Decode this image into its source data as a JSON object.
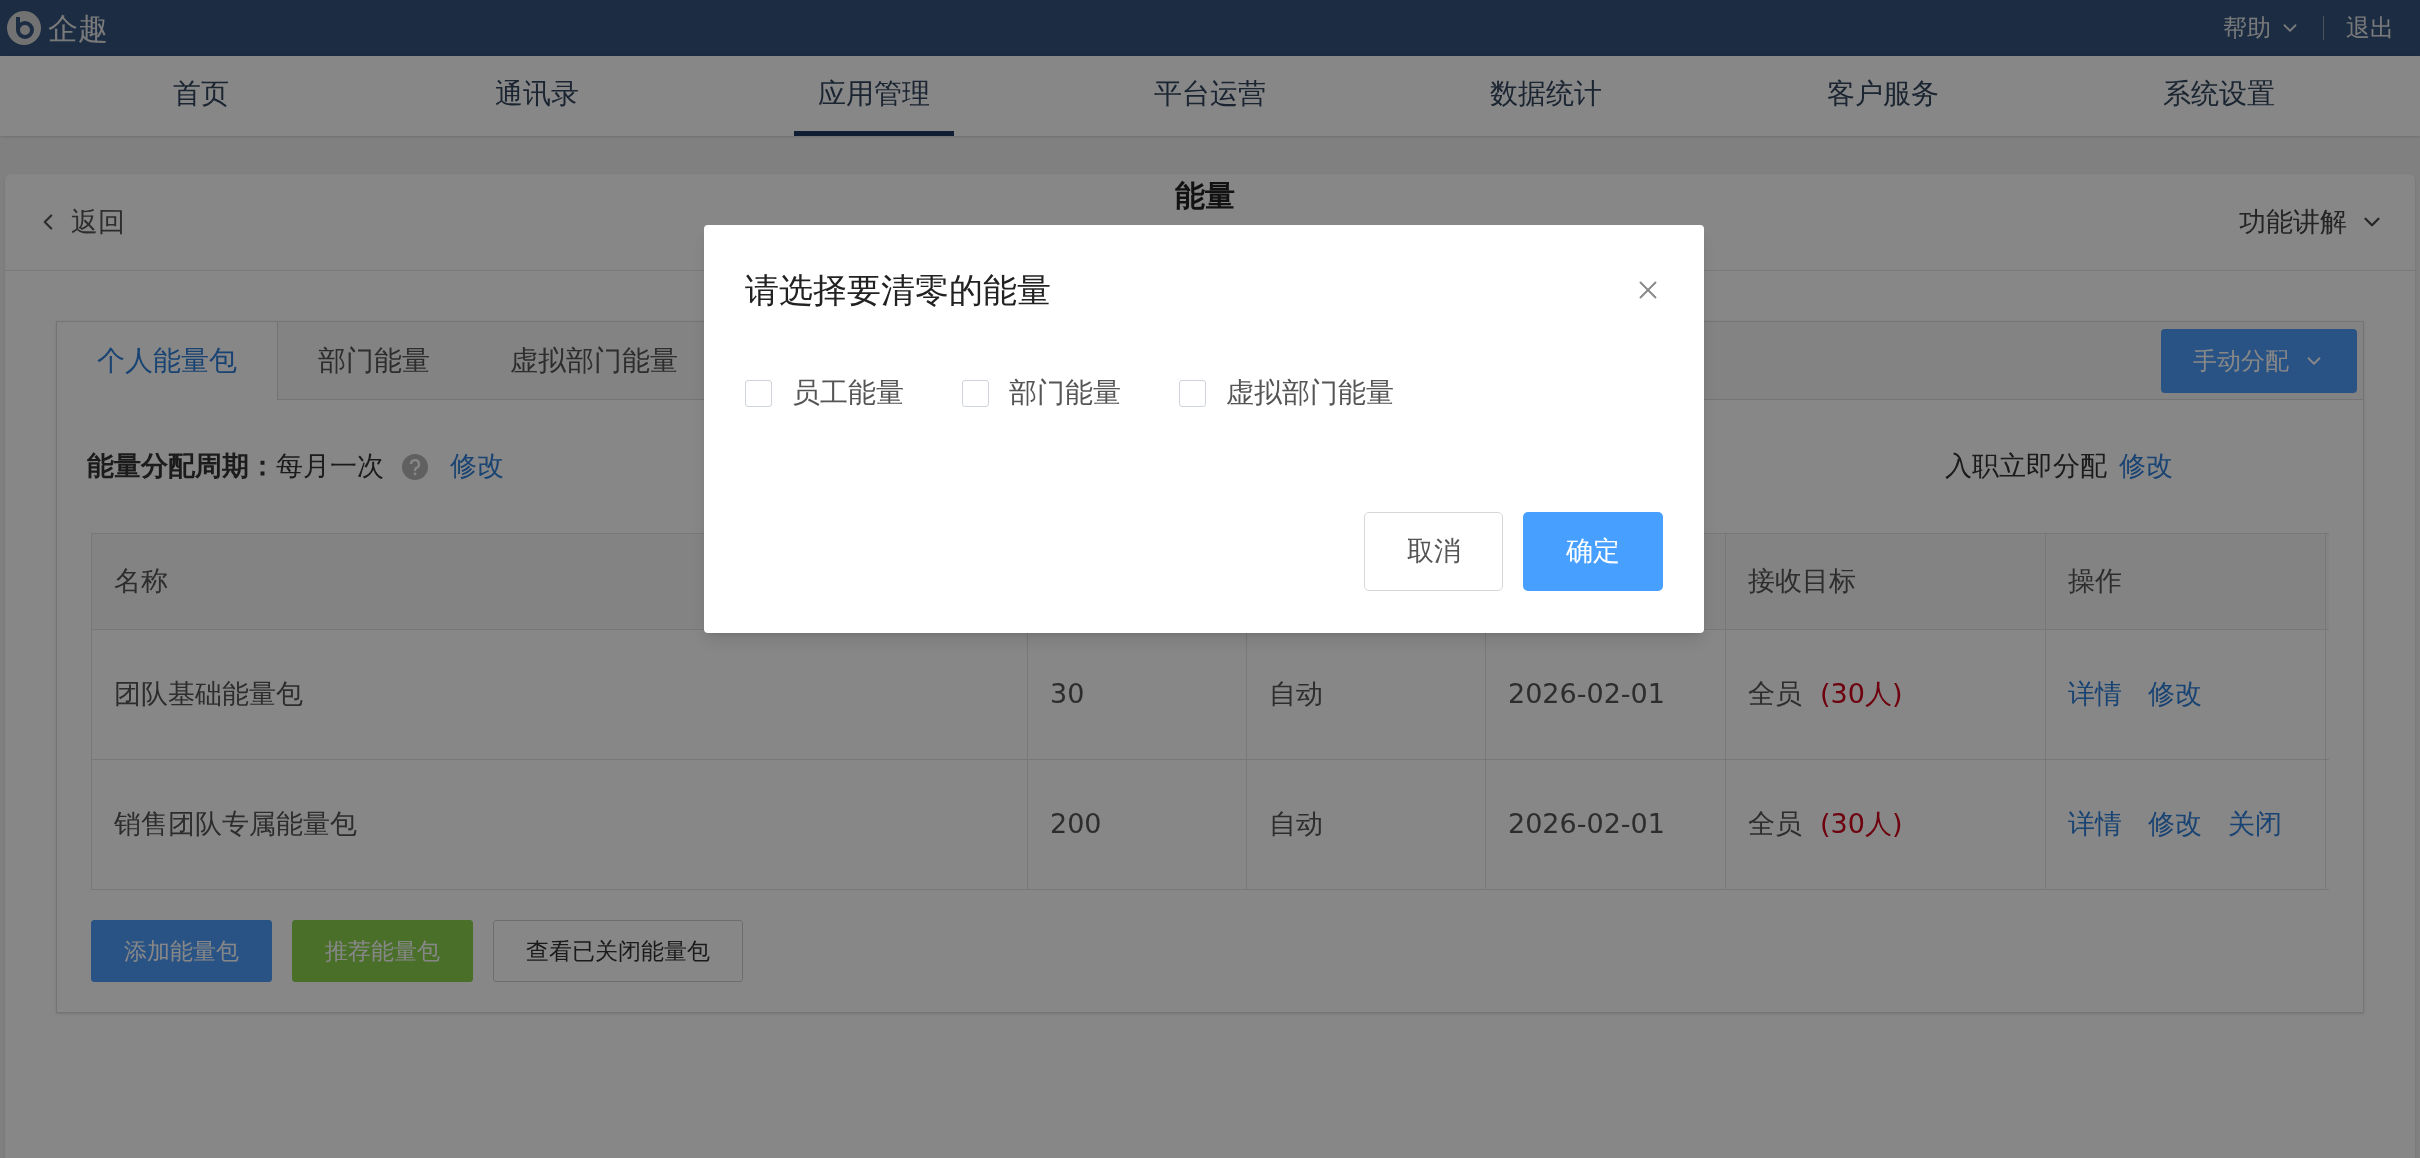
{
  "top_bar": {
    "brand": "企趣",
    "help": "帮助",
    "logout": "退出"
  },
  "nav": [
    {
      "label": "首页",
      "selected": false
    },
    {
      "label": "通讯录",
      "selected": false
    },
    {
      "label": "应用管理",
      "selected": true
    },
    {
      "label": "平台运营",
      "selected": false
    },
    {
      "label": "数据统计",
      "selected": false
    },
    {
      "label": "客户服务",
      "selected": false
    },
    {
      "label": "系统设置",
      "selected": false
    }
  ],
  "page_header": {
    "back": "返回",
    "title": "能量",
    "help_menu": "功能讲解"
  },
  "tabs": [
    {
      "label": "个人能量包",
      "selected": true
    },
    {
      "label": "部门能量",
      "selected": false
    },
    {
      "label": "虚拟部门能量",
      "selected": false
    }
  ],
  "distribute_button": "手动分配",
  "period": {
    "label": "能量分配周期：",
    "value": "每月一次",
    "edit": "修改",
    "column_2_value": "入职立即分配",
    "column_2_edit": "修改"
  },
  "table": {
    "header": {
      "name": "名称",
      "receiver": "接收目标",
      "actions": "操作"
    },
    "rows": [
      {
        "name": "团队基础能量包",
        "column_2": "30",
        "column_3": "自动",
        "column_4": "2026-02-01",
        "target": "全员",
        "count": "(30人)",
        "actions": [
          "详情",
          "修改"
        ]
      },
      {
        "name": "销售团队专属能量包",
        "column_2": "200",
        "column_3": "自动",
        "column_4": "2026-02-01",
        "target": "全员",
        "count": "(30人)",
        "actions": [
          "详情",
          "修改",
          "关闭"
        ]
      }
    ]
  },
  "footer_buttons": [
    {
      "label": "添加能量包",
      "kind": "primary"
    },
    {
      "label": "推荐能量包",
      "kind": "success"
    },
    {
      "label": "查看已关闭能量包",
      "kind": "default"
    }
  ],
  "dialog": {
    "title": "请选择要清零的能量",
    "options": [
      {
        "label": "员工能量",
        "checked": false
      },
      {
        "label": "部门能量",
        "checked": false
      },
      {
        "label": "虚拟部门能量",
        "checked": false
      }
    ],
    "cancel": "取消",
    "confirm": "确定"
  }
}
